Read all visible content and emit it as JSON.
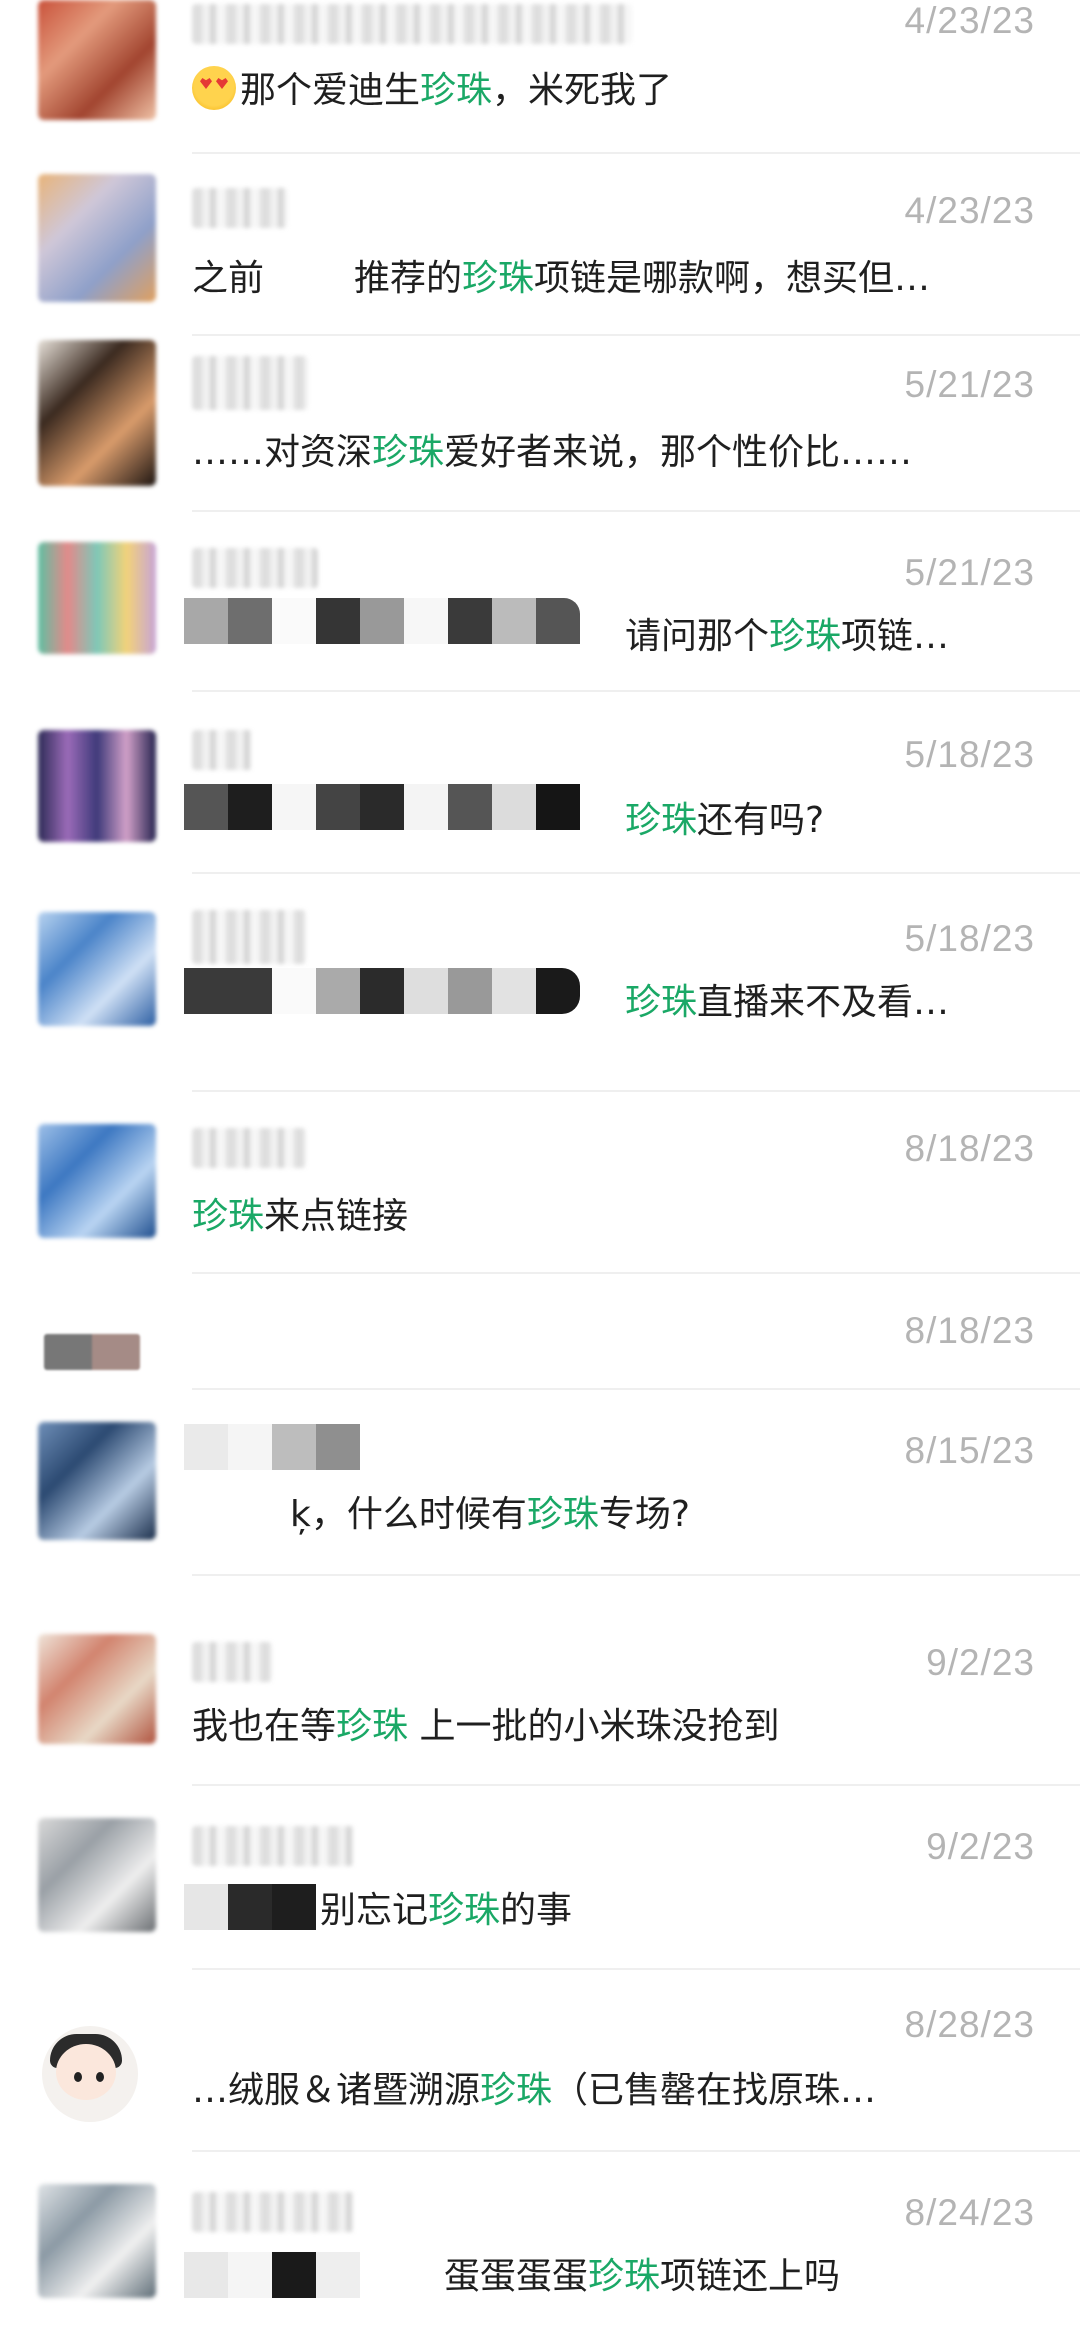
{
  "highlight_color": "#1aa866",
  "rows": [
    {
      "date": "4/23/23",
      "msg": {
        "pre": "那个爱迪生",
        "hl": "珍珠",
        "post": "，米死我了"
      }
    },
    {
      "date": "4/23/23",
      "msg": {
        "pre": "之前",
        "gap": "       ",
        "mid": "推荐的",
        "hl": "珍珠",
        "post": "项链是哪款啊，想买但…"
      }
    },
    {
      "date": "5/21/23",
      "msg": {
        "pre": "……对资深",
        "hl": "珍珠",
        "post": "爱好者来说，那个性价比……"
      }
    },
    {
      "date": "5/21/23",
      "msg": {
        "pre": "请问那个",
        "hl": "珍珠",
        "post": "项链…"
      }
    },
    {
      "date": "5/18/23",
      "msg": {
        "pre": "",
        "hl": "珍珠",
        "post": "还有吗?"
      }
    },
    {
      "date": "5/18/23",
      "msg": {
        "pre": "",
        "hl": "珍珠",
        "post": "直播来不及看…"
      }
    },
    {
      "date": "8/18/23",
      "msg": {
        "pre": "",
        "hl": "珍珠",
        "post": "来点链接"
      }
    },
    {
      "date": "8/18/23",
      "msg": {
        "pre": "",
        "hl": "",
        "post": ""
      }
    },
    {
      "date": "8/15/23",
      "msg": {
        "pre": "ķ，什么时候有",
        "hl": "珍珠",
        "post": "专场?"
      }
    },
    {
      "date": "9/2/23",
      "msg": {
        "pre": "我也在等",
        "hl": "珍珠",
        "post": "  上一批的小米珠没抢到"
      }
    },
    {
      "date": "9/2/23",
      "msg": {
        "pre": "别忘记",
        "hl": "珍珠",
        "post": "的事"
      }
    },
    {
      "date": "8/28/23",
      "msg": {
        "pre": "…绒服＆诸暨溯源",
        "hl": "珍珠",
        "post": "（已售罄在找原珠…"
      }
    },
    {
      "date": "8/24/23",
      "msg": {
        "pre": "蛋蛋蛋蛋",
        "hl": "珍珠",
        "post": "项链还上吗"
      }
    }
  ]
}
